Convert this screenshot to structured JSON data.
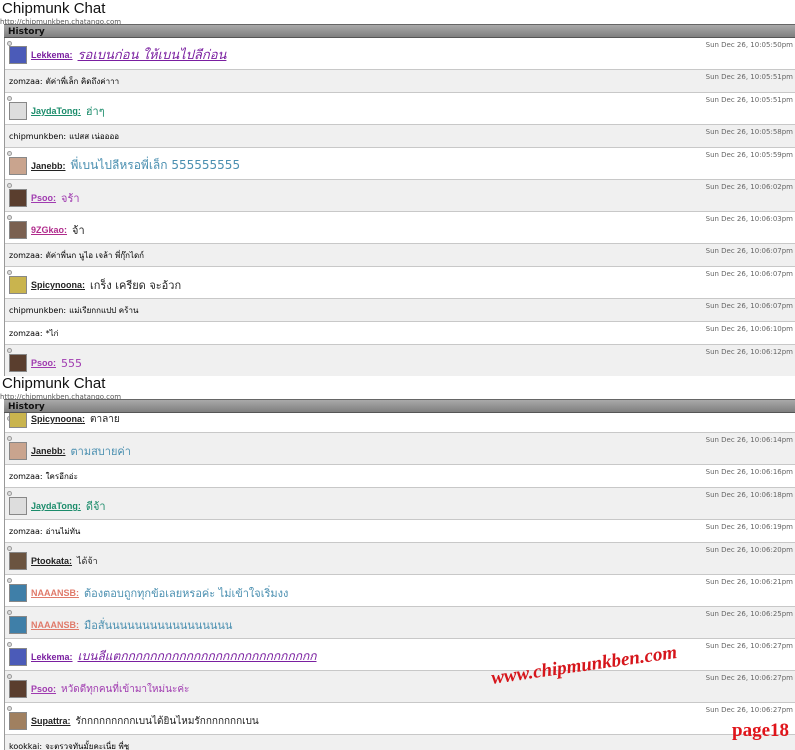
{
  "panels": [
    {
      "app_title": "Chipmunk Chat",
      "url": "http://chipmunkben.chatango.com",
      "history_label": "History",
      "messages": [
        {
          "kind": "user",
          "user": "Lekkema:",
          "user_color": "#7a1fa0",
          "text": "รอเบนก่อน ให้เบนไปลีก่อน",
          "text_color": "#7a1fa0",
          "italic": true,
          "underline": true,
          "size": 13,
          "timestamp": "Sun Dec 26, 10:05:50pm",
          "avatar_color": "#4b5bb8",
          "avatar_icon": "blue-wizard-avatar-icon"
        },
        {
          "kind": "anon",
          "user": "zomzaa:",
          "text": "ตัค่าพี่เล็ก คิดถึงค่าาา",
          "timestamp": "Sun Dec 26, 10:05:51pm"
        },
        {
          "kind": "user",
          "user": "JaydaTong:",
          "user_color": "#1b8c6b",
          "text": "ฮ่าๆ",
          "text_color": "#1b8c6b",
          "size": 11,
          "timestamp": "Sun Dec 26, 10:05:51pm",
          "avatar_color": "#dddddd",
          "avatar_icon": "panda-avatar-icon"
        },
        {
          "kind": "anon",
          "user": "chipmunkben:",
          "text": "แปสส เน่ออออ",
          "timestamp": "Sun Dec 26, 10:05:58pm"
        },
        {
          "kind": "user",
          "user": "Janebb:",
          "user_color": "#222222",
          "text": "พี่เบนไปลีหรอพี่เล็ก 555555555",
          "text_color": "#4a8fb0",
          "size": 12,
          "timestamp": "Sun Dec 26, 10:05:59pm",
          "avatar_color": "#c9a48e",
          "avatar_icon": "girl-photo-avatar-icon"
        },
        {
          "kind": "user",
          "user": "Psoo:",
          "user_color": "#a03bb0",
          "text": "จร้า",
          "text_color": "#a03bb0",
          "size": 11,
          "timestamp": "Sun Dec 26, 10:06:02pm",
          "avatar_color": "#5a3e2e",
          "avatar_icon": "dark-photo-avatar-icon"
        },
        {
          "kind": "user",
          "user": "9ZGkao:",
          "user_color": "#b02b8c",
          "text": "จ้า",
          "text_color": "#222222",
          "size": 11,
          "timestamp": "Sun Dec 26, 10:06:03pm",
          "avatar_color": "#7a6050",
          "avatar_icon": "photo-avatar-icon"
        },
        {
          "kind": "anon",
          "user": "zomzaa:",
          "text": "ตัค่าพี่นก นูไอ เจล้า พี่กุ๊กไดก์",
          "timestamp": "Sun Dec 26, 10:06:07pm"
        },
        {
          "kind": "user",
          "user": "Spicynoona:",
          "user_color": "#222222",
          "text": "เกร็ง เครียด จะอ้วก",
          "text_color": "#222222",
          "size": 11,
          "timestamp": "Sun Dec 26, 10:06:07pm",
          "avatar_color": "#c9b44e",
          "avatar_icon": "cartoon-avatar-icon"
        },
        {
          "kind": "anon",
          "user": "chipmunkben:",
          "text": "แม่เรียกกแปป คร้าน",
          "timestamp": "Sun Dec 26, 10:06:07pm"
        },
        {
          "kind": "anon",
          "user": "zomzaa:",
          "text": "*ไก่",
          "timestamp": "Sun Dec 26, 10:06:10pm"
        },
        {
          "kind": "user",
          "user": "Psoo:",
          "user_color": "#a03bb0",
          "text": "555",
          "text_color": "#a03bb0",
          "size": 11,
          "timestamp": "Sun Dec 26, 10:06:12pm",
          "avatar_color": "#5a3e2e",
          "avatar_icon": "dark-photo-avatar-icon"
        }
      ]
    },
    {
      "app_title": "Chipmunk Chat",
      "url": "http://chipmunkben.chatango.com",
      "history_label": "History",
      "messages": [
        {
          "kind": "user",
          "user": "Spicynoona:",
          "user_color": "#222222",
          "text": "ตาลาย",
          "text_color": "#222222",
          "size": 10,
          "timestamp": "",
          "avatar_color": "#c9b44e",
          "avatar_icon": "cartoon-avatar-icon"
        },
        {
          "kind": "user",
          "user": "Janebb:",
          "user_color": "#222222",
          "text": "ตามสบายค่า",
          "text_color": "#4a8fb0",
          "size": 11,
          "timestamp": "Sun Dec 26, 10:06:14pm",
          "avatar_color": "#c9a48e",
          "avatar_icon": "girl-photo-avatar-icon"
        },
        {
          "kind": "anon",
          "user": "zomzaa:",
          "text": "ใครอีกอ่ะ",
          "timestamp": "Sun Dec 26, 10:06:16pm"
        },
        {
          "kind": "user",
          "user": "JaydaTong:",
          "user_color": "#1b8c6b",
          "text": "ดีจ้า",
          "text_color": "#1b8c6b",
          "size": 11,
          "timestamp": "Sun Dec 26, 10:06:18pm",
          "avatar_color": "#dddddd",
          "avatar_icon": "panda-avatar-icon"
        },
        {
          "kind": "anon",
          "user": "zomzaa:",
          "text": "อ่านไม่ทัน",
          "timestamp": "Sun Dec 26, 10:06:19pm"
        },
        {
          "kind": "user",
          "user": "Ptookata:",
          "user_color": "#222222",
          "text": "ได้จ้า",
          "text_color": "#222222",
          "size": 9,
          "timestamp": "Sun Dec 26, 10:06:20pm",
          "avatar_color": "#6b5440",
          "avatar_icon": "photo-avatar-icon"
        },
        {
          "kind": "user",
          "user": "NAAANSB:",
          "user_color": "#e07a6a",
          "text": "ต้องตอบถูกทุกข้อเลยหรอค่ะ ไม่เข้าใจเริ่มงง",
          "text_color": "#4a8fb0",
          "size": 11,
          "timestamp": "Sun Dec 26, 10:06:21pm",
          "avatar_color": "#3f7fa8",
          "avatar_icon": "landscape-avatar-icon"
        },
        {
          "kind": "user",
          "user": "NAAANSB:",
          "user_color": "#e07a6a",
          "text": "มือสั่นนนนนนนนนนนนนนนนน",
          "text_color": "#4a8fb0",
          "size": 11,
          "timestamp": "Sun Dec 26, 10:06:25pm",
          "avatar_color": "#3f7fa8",
          "avatar_icon": "landscape-avatar-icon"
        },
        {
          "kind": "user",
          "user": "Lekkema:",
          "user_color": "#7a1fa0",
          "text": "เบนลีแตกกกกกกกกกกกกกกกกกกกกกกกกกกก",
          "text_color": "#7a1fa0",
          "italic": true,
          "underline": true,
          "size": 12,
          "timestamp": "Sun Dec 26, 10:06:27pm",
          "avatar_color": "#4b5bb8",
          "avatar_icon": "blue-wizard-avatar-icon"
        },
        {
          "kind": "user",
          "user": "Psoo:",
          "user_color": "#a03bb0",
          "text": "หวัดดีทุกคนที่เข้ามาใหม่นะค่ะ",
          "text_color": "#a03bb0",
          "size": 10,
          "timestamp": "Sun Dec 26, 10:06:27pm",
          "avatar_color": "#5a3e2e",
          "avatar_icon": "dark-photo-avatar-icon"
        },
        {
          "kind": "user",
          "user": "Supattra:",
          "user_color": "#222222",
          "text": "รักกกกกกกกกเบนได้ยินไหมรักกกกกกกเบน",
          "text_color": "#222222",
          "size": 10,
          "timestamp": "Sun Dec 26, 10:06:27pm",
          "avatar_color": "#a08060",
          "avatar_icon": "photo-avatar-icon"
        },
        {
          "kind": "anon",
          "user": "kookkai:",
          "text": "จะตรวจทันมั้ยคะเนี่ย พี่ชู",
          "timestamp": ""
        }
      ]
    }
  ],
  "watermark": "www.chipmunkben.com",
  "page_label": "page18"
}
